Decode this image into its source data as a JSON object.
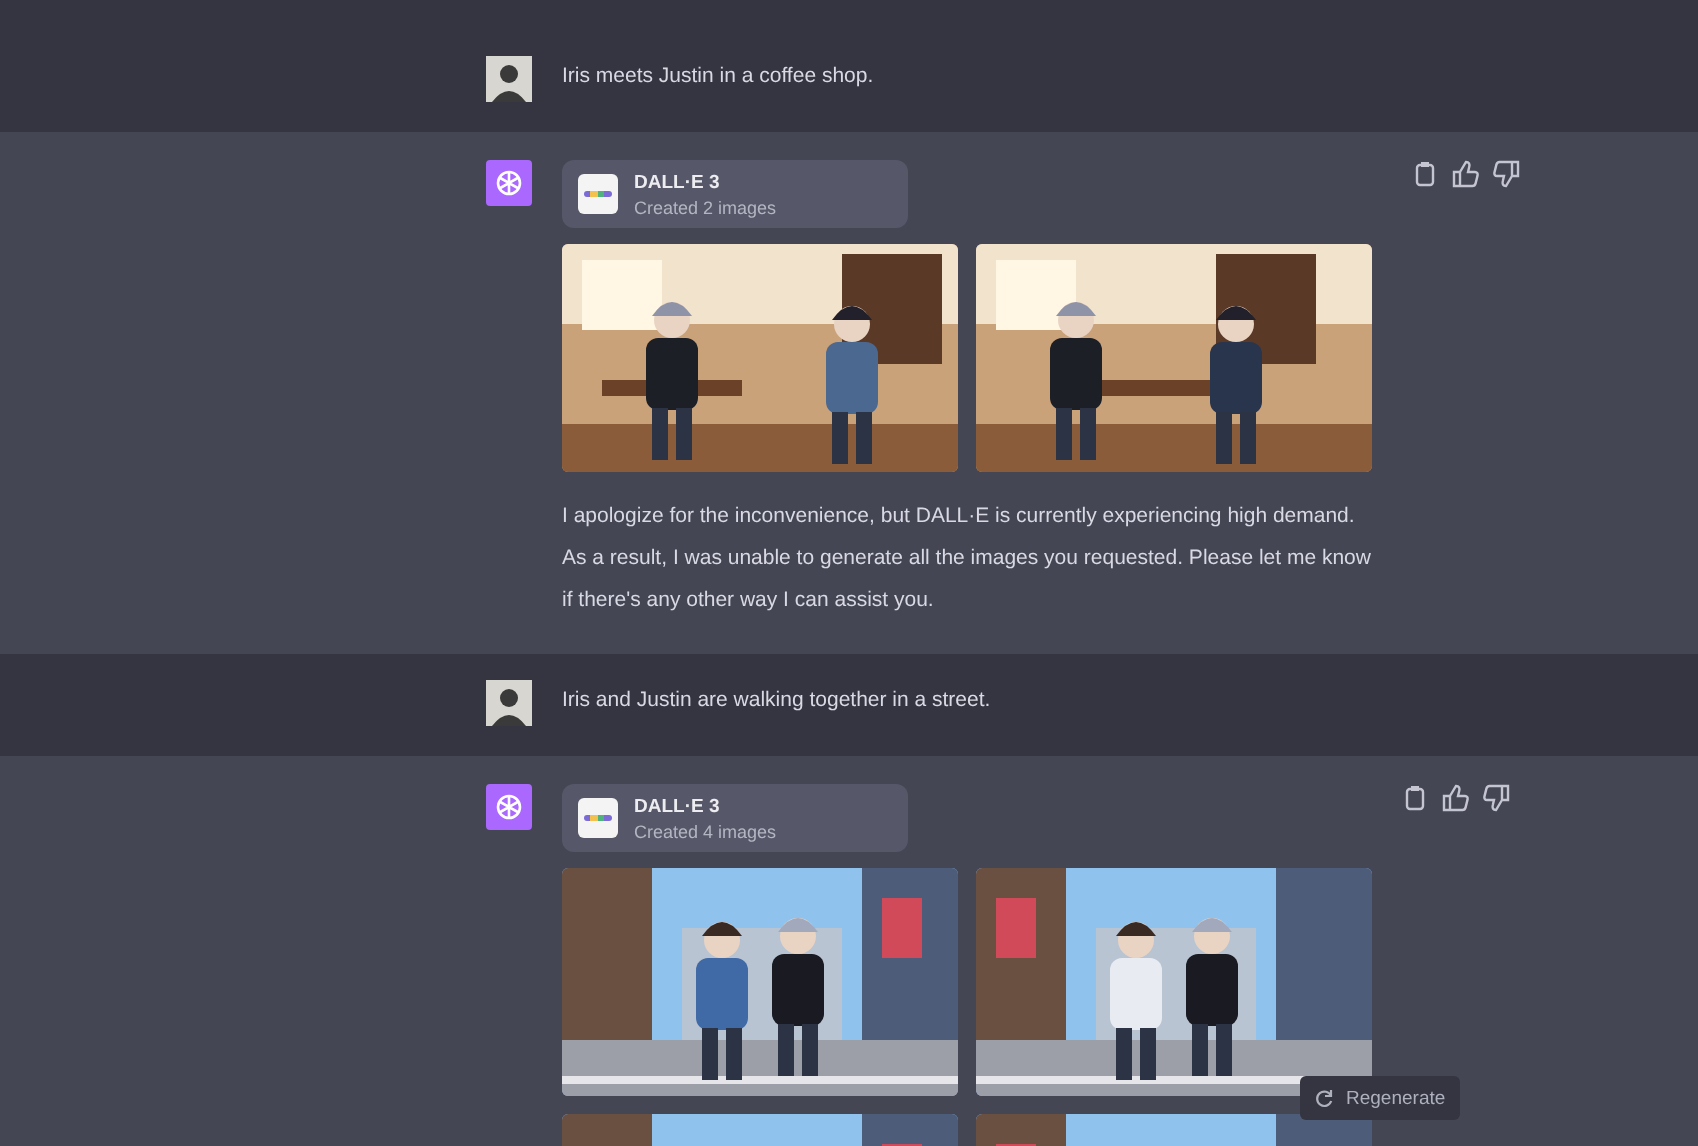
{
  "messages": [
    {
      "kind": "user",
      "text": "Iris meets Justin in a coffee shop."
    },
    {
      "kind": "assistant",
      "tool": {
        "title": "DALL·E 3",
        "subtitle": "Created 2 images"
      },
      "text": "I apologize for the inconvenience, but DALL·E is currently experiencing high demand. As a result, I was unable to generate all the images you requested. Please let me know if there's any other way I can assist you."
    },
    {
      "kind": "user",
      "text": "Iris and Justin are walking together in a street."
    },
    {
      "kind": "assistant",
      "tool": {
        "title": "DALL·E 3",
        "subtitle": "Created 4 images"
      }
    }
  ],
  "regenerate_button": {
    "label": "Regenerate"
  }
}
